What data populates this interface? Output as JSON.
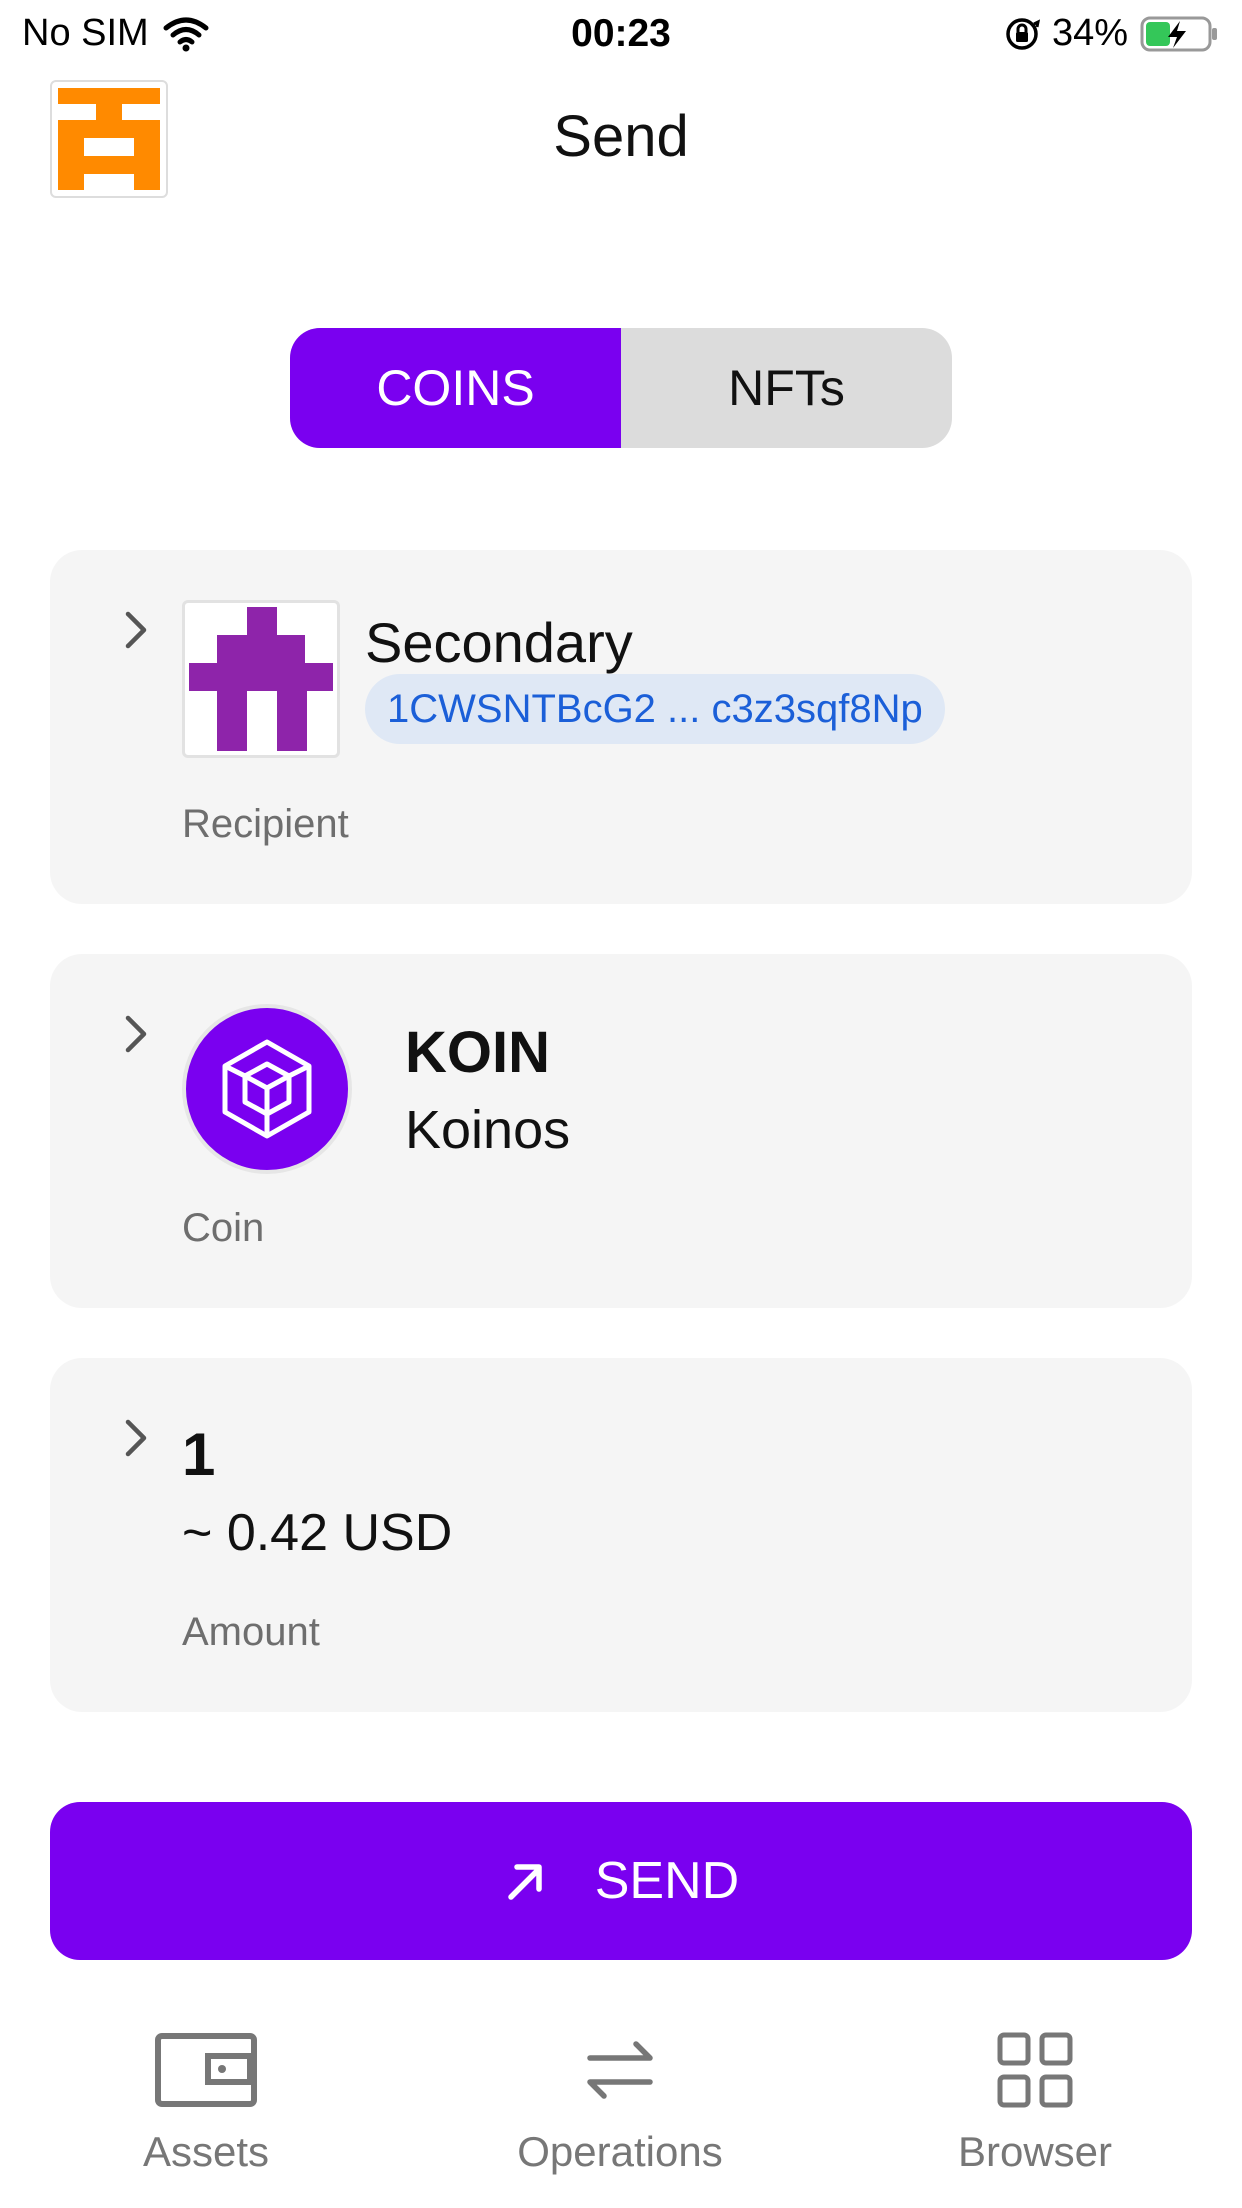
{
  "status_bar": {
    "carrier": "No SIM",
    "time": "00:23",
    "battery": "34%"
  },
  "header": {
    "title": "Send"
  },
  "segmented": {
    "coins_label": "COINS",
    "nfts_label": "NFTs",
    "selected": "COINS"
  },
  "recipient": {
    "name": "Secondary",
    "address": "1CWSNTBcG2 ... c3z3sqf8Np",
    "label": "Recipient"
  },
  "coin": {
    "symbol": "KOIN",
    "name": "Koinos",
    "label": "Coin"
  },
  "amount": {
    "value": "1",
    "fiat": "~ 0.42 USD",
    "label": "Amount"
  },
  "send_button": {
    "label": "SEND"
  },
  "bottom_nav": {
    "items": [
      {
        "label": "Assets",
        "icon": "wallet-icon"
      },
      {
        "label": "Operations",
        "icon": "swap-arrows-icon"
      },
      {
        "label": "Browser",
        "icon": "grid-icon"
      }
    ]
  },
  "colors": {
    "accent": "#7a00f0",
    "avatar_orange": "#ff8a00",
    "identicon_purple": "#8e24aa",
    "address_text": "#1b5fd8",
    "address_bg": "#dfe8f5",
    "card_bg": "#f5f5f5"
  }
}
